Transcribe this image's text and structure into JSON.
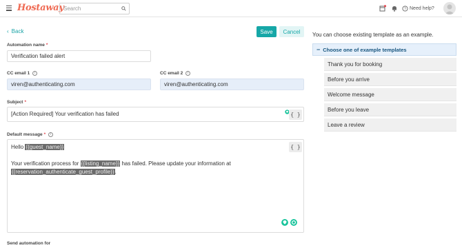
{
  "header": {
    "logo": "Hostaway",
    "search_placeholder": "Search",
    "help_label": "Need help?"
  },
  "toolbar": {
    "back_label": "Back",
    "save_label": "Save",
    "cancel_label": "Cancel"
  },
  "form": {
    "automation_name": {
      "label": "Automation name",
      "required": "*",
      "value": "Verification failed alert"
    },
    "cc_email_1": {
      "label": "CC email 1",
      "value": "viren@authenticating.com"
    },
    "cc_email_2": {
      "label": "CC email 2",
      "value": "viren@authenticating.com"
    },
    "subject": {
      "label": "Subject",
      "required": "*",
      "value": "[Action Required] Your verification has failed"
    },
    "default_message": {
      "label": "Default message",
      "required": "*",
      "greeting": "Hello ",
      "guest_name_token": "{{guest_name}}",
      "body_part1": "Your verification process for ",
      "listing_name_token": "{{listing_name}}",
      "body_part2": " has failed. Please update your information at",
      "profile_token": "{{reservation_authenticate_guest_profile}}",
      "body_end": "."
    },
    "send_automation_label": "Send automation for",
    "variable_button": "{ }"
  },
  "templates": {
    "hint": "You can choose existing template as an example.",
    "header_label": "Choose one of example templates",
    "items": [
      "Thank you for booking",
      "Before you arrive",
      "Welcome message",
      "Before you leave",
      "Leave a review"
    ]
  },
  "colors": {
    "accent": "#16a7a7",
    "brand": "#ef6a53",
    "required": "#e0464e",
    "grammarly": "#15c39a"
  }
}
